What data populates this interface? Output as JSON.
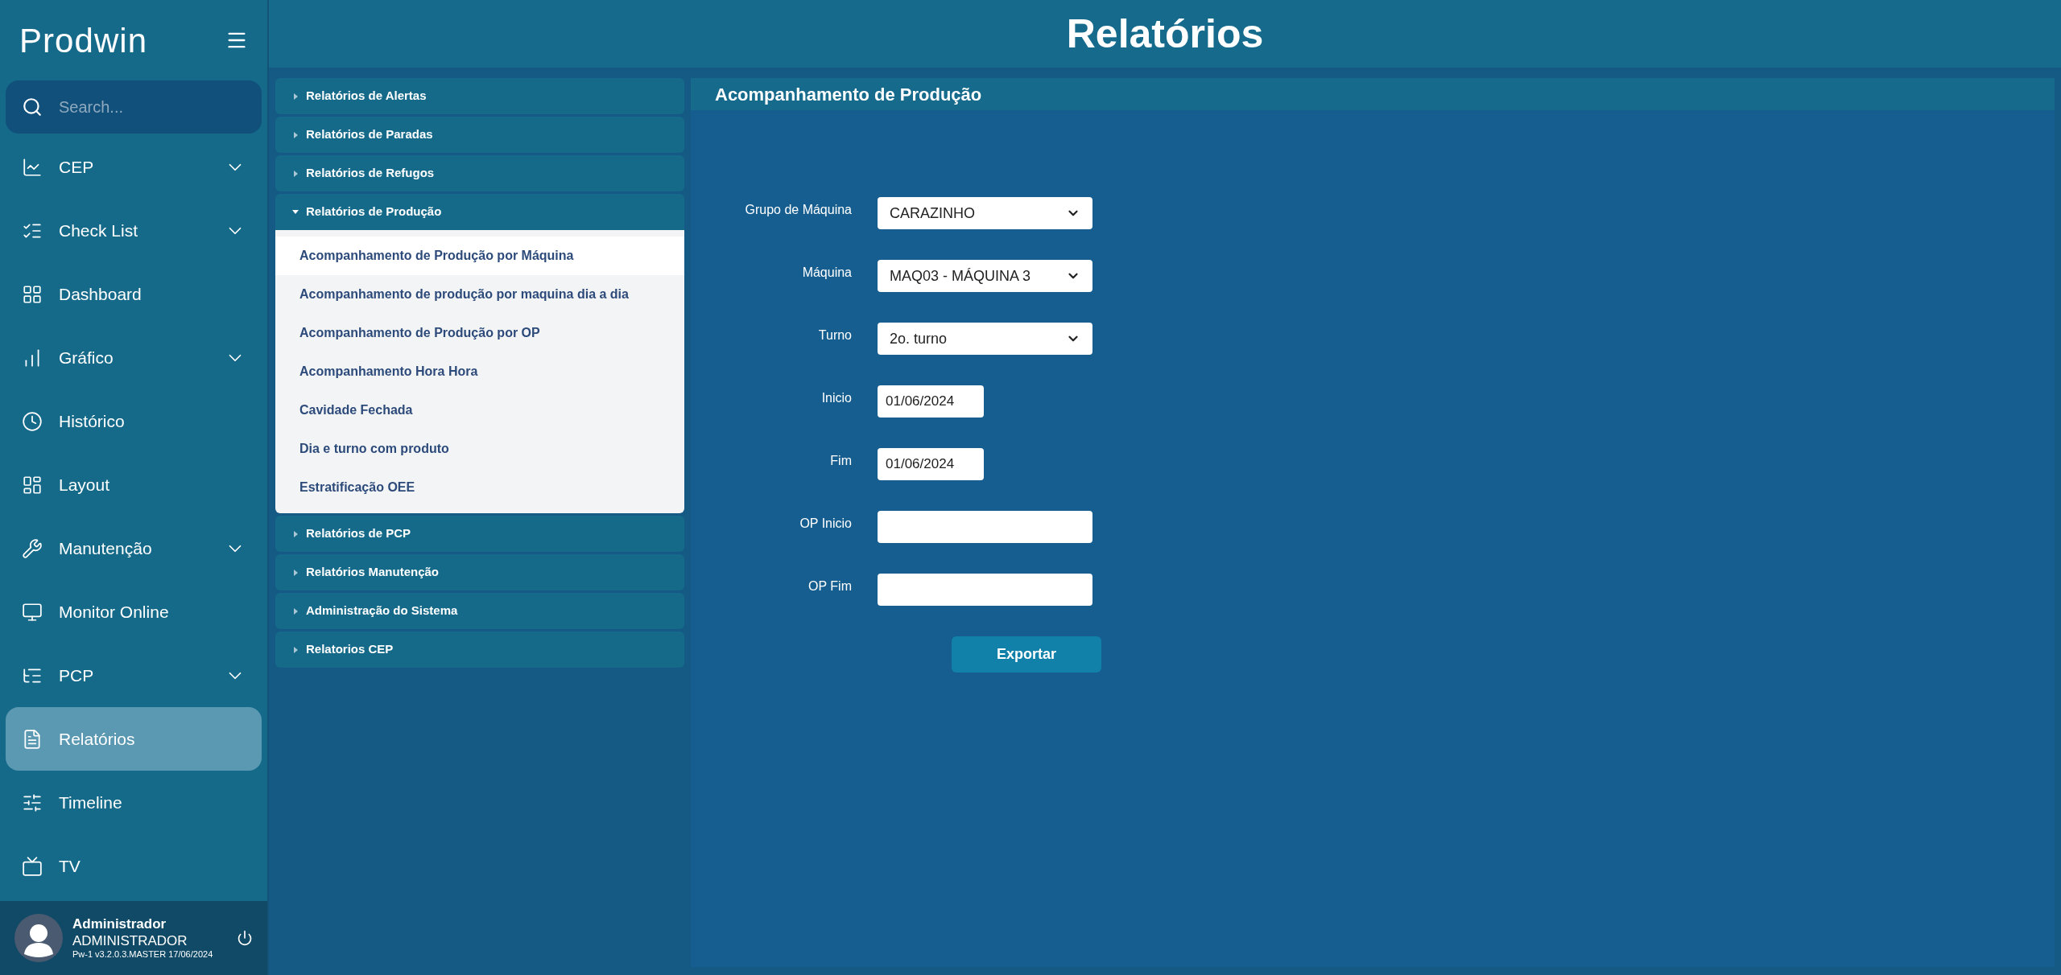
{
  "app": {
    "logo": "Prodwin"
  },
  "search": {
    "placeholder": "Search..."
  },
  "sidebar": {
    "items": [
      {
        "label": "CEP",
        "has_submenu": true,
        "selected": false
      },
      {
        "label": "Check List",
        "has_submenu": true,
        "selected": false
      },
      {
        "label": "Dashboard",
        "has_submenu": false,
        "selected": false
      },
      {
        "label": "Gráfico",
        "has_submenu": true,
        "selected": false
      },
      {
        "label": "Histórico",
        "has_submenu": false,
        "selected": false
      },
      {
        "label": "Layout",
        "has_submenu": false,
        "selected": false
      },
      {
        "label": "Manutenção",
        "has_submenu": true,
        "selected": false
      },
      {
        "label": "Monitor Online",
        "has_submenu": false,
        "selected": false
      },
      {
        "label": "PCP",
        "has_submenu": true,
        "selected": false
      },
      {
        "label": "Relatórios",
        "has_submenu": false,
        "selected": true
      },
      {
        "label": "Timeline",
        "has_submenu": false,
        "selected": false
      },
      {
        "label": "TV",
        "has_submenu": false,
        "selected": false
      }
    ]
  },
  "user": {
    "name": "Administrador",
    "role": "ADMINISTRADOR",
    "version": "Pw-1 v3.2.0.3.MASTER 17/06/2024"
  },
  "header": {
    "title": "Relatórios"
  },
  "report_tree": [
    {
      "label": "Relatórios de Alertas",
      "expanded": false
    },
    {
      "label": "Relatórios de Paradas",
      "expanded": false
    },
    {
      "label": "Relatórios de Refugos",
      "expanded": false
    },
    {
      "label": "Relatórios de Produção",
      "expanded": true,
      "children": [
        {
          "label": "Acompanhamento de Produção por Máquina",
          "selected": true
        },
        {
          "label": "Acompanhamento de produção por maquina dia a dia",
          "selected": false
        },
        {
          "label": "Acompanhamento de Produção por OP",
          "selected": false
        },
        {
          "label": "Acompanhamento Hora Hora",
          "selected": false
        },
        {
          "label": "Cavidade Fechada",
          "selected": false
        },
        {
          "label": "Dia e turno com produto",
          "selected": false
        },
        {
          "label": "Estratificação OEE",
          "selected": false
        }
      ]
    },
    {
      "label": "Relatórios de PCP",
      "expanded": false
    },
    {
      "label": "Relatórios Manutenção",
      "expanded": false
    },
    {
      "label": "Administração do Sistema",
      "expanded": false
    },
    {
      "label": "Relatorios CEP",
      "expanded": false
    }
  ],
  "form": {
    "title": "Acompanhamento de Produção",
    "fields": [
      {
        "label": "Grupo de Máquina",
        "kind": "select",
        "value": "CARAZINHO"
      },
      {
        "label": "Máquina",
        "kind": "select",
        "value": "MAQ03 - MÁQUINA 3"
      },
      {
        "label": "Turno",
        "kind": "select",
        "value": "2o. turno"
      },
      {
        "label": "Inicio",
        "kind": "date",
        "value": "01/06/2024"
      },
      {
        "label": "Fim",
        "kind": "date",
        "value": "01/06/2024"
      },
      {
        "label": "OP Inicio",
        "kind": "text"
      },
      {
        "label": "OP Fim",
        "kind": "text"
      }
    ],
    "button": "Exportar"
  }
}
